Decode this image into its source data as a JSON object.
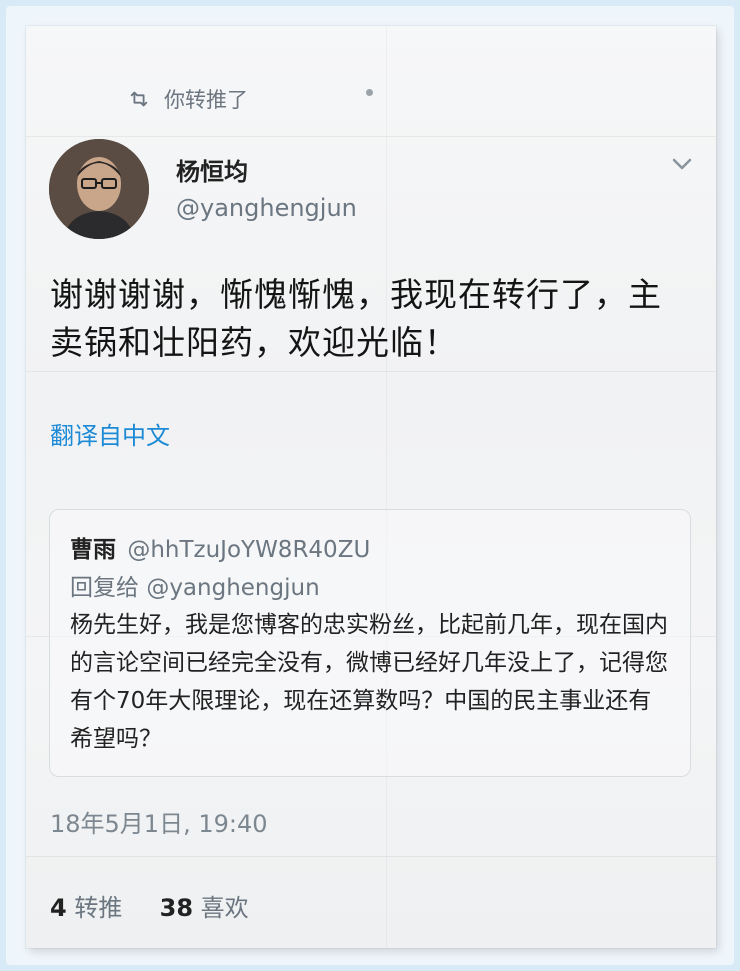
{
  "retweet_banner": {
    "icon": "retweet-icon",
    "label": "你转推了"
  },
  "author": {
    "name": "杨恒均",
    "handle": "@yanghengjun",
    "avatar": "avatar-photo"
  },
  "menu": {
    "icon": "chevron-down-icon"
  },
  "tweet": {
    "text": "谢谢谢谢，惭愧惭愧，我现在转行了，主卖锅和壮阳药，欢迎光临！",
    "translate_label": "翻译自中文"
  },
  "quoted_reply": {
    "name": "曹雨",
    "handle": "@hhTzuJoYW8R40ZU",
    "reply_to_prefix": "回复给",
    "reply_to_handle": "@yanghengjun",
    "text": "杨先生好，我是您博客的忠实粉丝，比起前几年，现在国内的言论空间已经完全没有，微博已经好几年没上了，记得您有个70年大限理论，现在还算数吗？中国的民主事业还有希望吗？"
  },
  "timestamp": "18年5月1日, 19:40",
  "stats": {
    "retweets_count": "4",
    "retweets_label": "转推",
    "likes_count": "38",
    "likes_label": "喜欢"
  },
  "colors": {
    "background_frame": "#d9eaf7",
    "link": "#1d8ad6",
    "muted_text": "#6b7680",
    "primary_text": "#141414"
  }
}
